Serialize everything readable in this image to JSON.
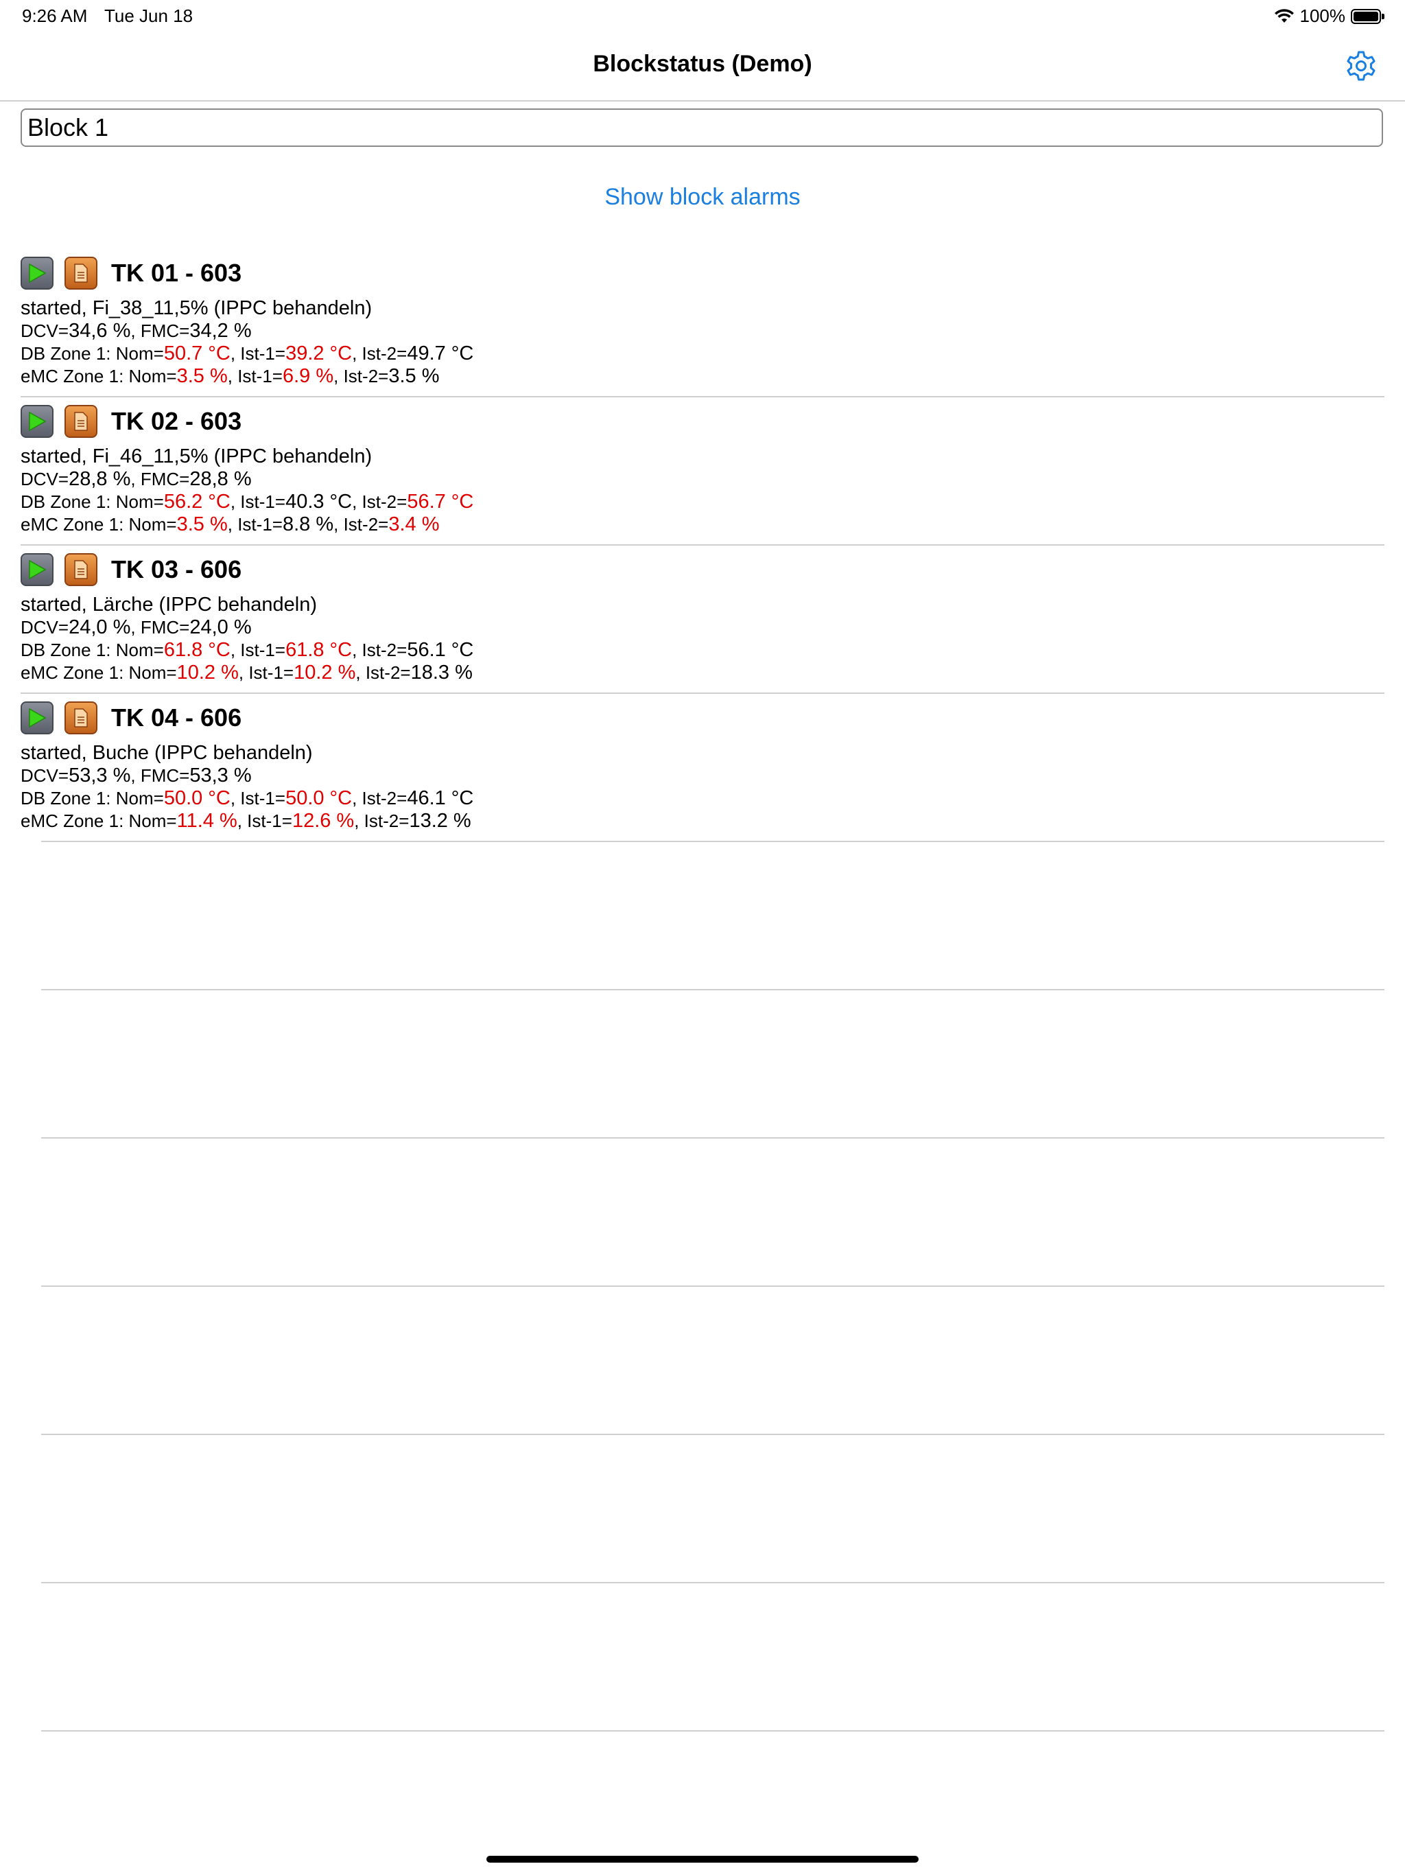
{
  "status_bar": {
    "time": "9:26 AM",
    "date": "Tue Jun 18",
    "battery": "100%"
  },
  "nav": {
    "title": "Blockstatus (Demo)"
  },
  "block_field": {
    "value": "Block 1"
  },
  "show_alarms_label": "Show block alarms",
  "rows": [
    {
      "title": "TK 01 - 603",
      "status": "started, Fi_38_11,5% (IPPC behandeln)",
      "dcv_label": "DCV=",
      "dcv": "34,6 %",
      "fmc_label": ", FMC=",
      "fmc": "34,2 %",
      "db_label": "DB Zone  1: Nom=",
      "db_nom": "50.7 °C",
      "db_ist1_label": ", Ist-1=",
      "db_ist1": "39.2 °C",
      "db_ist2_label": ", Ist-2=",
      "db_ist2": "49.7 °C",
      "emc_label": "eMC Zone  1: Nom=",
      "emc_nom": "3.5 %",
      "emc_ist1_label": ", Ist-1=",
      "emc_ist1": "6.9 %",
      "emc_ist2_label": ", Ist-2=",
      "emc_ist2": "3.5 %"
    },
    {
      "title": "TK 02 - 603",
      "status": "started, Fi_46_11,5% (IPPC behandeln)",
      "dcv_label": "DCV=",
      "dcv": "28,8 %",
      "fmc_label": ", FMC=",
      "fmc": "28,8 %",
      "db_label": "DB Zone  1: Nom=",
      "db_nom": "56.2 °C",
      "db_ist1_label": ", Ist-1=",
      "db_ist1": "40.3 °C",
      "db_ist2_label": ", Ist-2=",
      "db_ist2": "56.7 °C",
      "emc_label": "eMC Zone  1: Nom=",
      "emc_nom": "3.5 %",
      "emc_ist1_label": ", Ist-1=",
      "emc_ist1": "8.8 %",
      "emc_ist2_label": ", Ist-2=",
      "emc_ist2": "3.4 %"
    },
    {
      "title": "TK 03 - 606",
      "status": "started, Lärche (IPPC behandeln)",
      "dcv_label": "DCV=",
      "dcv": "24,0 %",
      "fmc_label": ", FMC=",
      "fmc": "24,0 %",
      "db_label": "DB Zone  1: Nom=",
      "db_nom": "61.8 °C",
      "db_ist1_label": ", Ist-1=",
      "db_ist1": "61.8 °C",
      "db_ist2_label": ", Ist-2=",
      "db_ist2": "56.1 °C",
      "emc_label": "eMC Zone  1: Nom=",
      "emc_nom": "10.2 %",
      "emc_ist1_label": ", Ist-1=",
      "emc_ist1": "10.2 %",
      "emc_ist2_label": ", Ist-2=",
      "emc_ist2": "18.3 %"
    },
    {
      "title": "TK 04 - 606",
      "status": "started, Buche (IPPC behandeln)",
      "dcv_label": "DCV=",
      "dcv": "53,3 %",
      "fmc_label": ", FMC=",
      "fmc": "53,3 %",
      "db_label": "DB Zone  1: Nom=",
      "db_nom": "50.0 °C",
      "db_ist1_label": ", Ist-1=",
      "db_ist1": "50.0 °C",
      "db_ist2_label": ", Ist-2=",
      "db_ist2": "46.1 °C",
      "emc_label": "eMC Zone  1: Nom=",
      "emc_nom": "11.4 %",
      "emc_ist1_label": ", Ist-1=",
      "emc_ist1": "12.6 %",
      "emc_ist2_label": ", Ist-2=",
      "emc_ist2": "13.2 %"
    }
  ],
  "colors": {
    "accent": "#1a7fe0",
    "alarm_red": "#e00000",
    "separator": "#d0d0d0"
  },
  "icons": {
    "settings": "gear-icon",
    "play": "play-icon",
    "document": "document-icon",
    "wifi": "wifi-icon",
    "battery": "battery-icon"
  }
}
